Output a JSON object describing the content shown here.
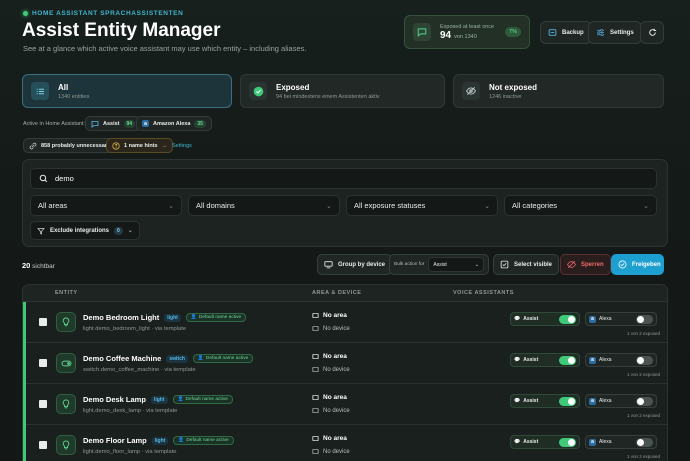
{
  "header": {
    "eyebrow": "HOME ASSISTANT SPRACHASSISTENTEN",
    "title": "Assist Entity Manager",
    "subtitle": "See at a glance which active voice assistant may use which entity – including aliases."
  },
  "stat": {
    "label": "Exposed at least once",
    "value": "94",
    "of": "von 1340",
    "percent": "7%"
  },
  "actions": {
    "backup": "Backup",
    "settings": "Settings"
  },
  "cards": [
    {
      "name": "All",
      "desc": "1340 entities"
    },
    {
      "name": "Exposed",
      "desc": "94 bei mindestens einem Assistenten aktiv"
    },
    {
      "name": "Not exposed",
      "desc": "1246 inactive"
    }
  ],
  "assistants_bar": {
    "label": "Active in Home Assistant:",
    "assist": "Assist",
    "assist_count": "94",
    "alexa": "Amazon Alexa",
    "alexa_count": "35",
    "unnecessary": "858 probably unnecessary",
    "hints": "1 name hints",
    "settings_link": "Settings"
  },
  "filters": {
    "search_value": "demo",
    "areas": "All areas",
    "domains": "All domains",
    "statuses": "All exposure statuses",
    "categories": "All categories",
    "exclude": "Exclude integrations",
    "exclude_count": "0"
  },
  "toolbar": {
    "visible_count": "20",
    "visible_label": "sichtbar",
    "group_by_device": "Group by device",
    "bulk_label": "Bulk action for",
    "bulk_value": "Assist",
    "select_visible": "Select visible",
    "block": "Sperren",
    "release": "Freigeben"
  },
  "table": {
    "col_entity": "ENTITY",
    "col_area": "AREA & DEVICE",
    "col_voice": "VOICE ASSISTANTS",
    "rows": [
      {
        "name": "Demo Bedroom Light",
        "domain": "light",
        "hint": "Default name active",
        "id": "light.demo_bedroom_light · via template",
        "area": "No area",
        "device": "No device",
        "assist": "Assist",
        "alexa": "Alexa",
        "exposed": "1 von 2 exposed"
      },
      {
        "name": "Demo Coffee Machine",
        "domain": "switch",
        "hint": "Default name active",
        "id": "switch.demo_coffee_machine · via template",
        "area": "No area",
        "device": "No device",
        "assist": "Assist",
        "alexa": "Alexa",
        "exposed": "1 von 2 exposed"
      },
      {
        "name": "Demo Desk Lamp",
        "domain": "light",
        "hint": "Default name active",
        "id": "light.demo_desk_lamp · via template",
        "area": "No area",
        "device": "No device",
        "assist": "Assist",
        "alexa": "Alexa",
        "exposed": "1 von 2 exposed"
      },
      {
        "name": "Demo Floor Lamp",
        "domain": "light",
        "hint": "Default name active",
        "id": "light.demo_floor_lamp · via template",
        "area": "No area",
        "device": "No device",
        "assist": "Assist",
        "alexa": "Alexa",
        "exposed": "1 von 2 exposed"
      }
    ]
  }
}
